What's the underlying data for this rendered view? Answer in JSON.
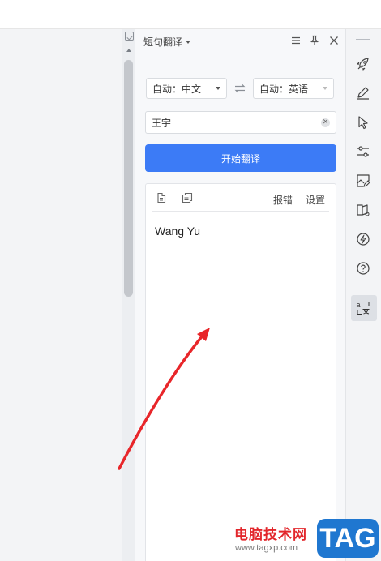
{
  "panel": {
    "title": "短句翻译",
    "source_lang": "自动：中文",
    "target_lang": "自动：英语",
    "input_value": "王宇",
    "translate_label": "开始翻译",
    "report_label": "报错",
    "settings_label": "设置",
    "result": "Wang Yu"
  },
  "watermark": {
    "site_name": "电脑技术网",
    "url": "www.tagxp.com",
    "badge": "TAG"
  },
  "colors": {
    "accent": "#3c7bf6",
    "arrow": "#e8262a",
    "badge": "#1f77d0"
  },
  "icons": {
    "rightbar": [
      "rocket-icon",
      "pen-icon",
      "cursor-icon",
      "sliders-icon",
      "image-edit-icon",
      "book-icon",
      "bulb-icon",
      "help-icon",
      "translate-icon"
    ]
  }
}
